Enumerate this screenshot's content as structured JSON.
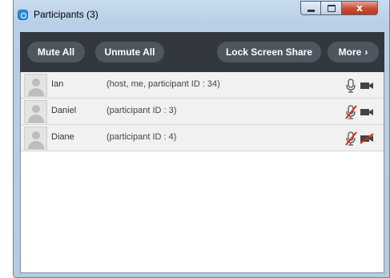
{
  "window": {
    "title": "Participants (3)",
    "close_symbol": "x"
  },
  "toolbar": {
    "mute_all": "Mute All",
    "unmute_all": "Unmute All",
    "lock_screen_share": "Lock Screen Share",
    "more": "More",
    "more_chevron": "›"
  },
  "participants": [
    {
      "name": "Ian",
      "detail": "(host, me, participant ID : 34)",
      "mic": "mic-on-icon",
      "video": "camera-on-icon"
    },
    {
      "name": "Daniel",
      "detail": "(participant ID : 3)",
      "mic": "mic-muted-icon",
      "video": "camera-on-icon"
    },
    {
      "name": "Diane",
      "detail": "(participant ID : 4)",
      "mic": "mic-muted-icon",
      "video": "camera-off-icon"
    }
  ],
  "colors": {
    "toolbar_bg": "#33383e",
    "toolbar_button": "#4e5760",
    "muted_red": "#d42a1e",
    "titlebar": "#c9dcef"
  }
}
